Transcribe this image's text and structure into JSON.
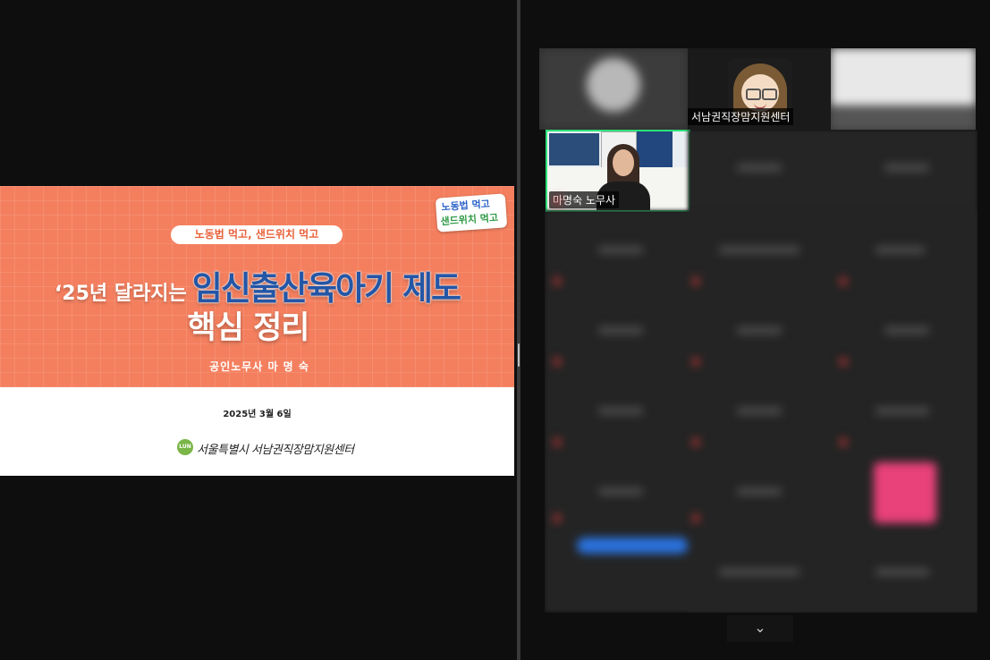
{
  "slide": {
    "series_label": "노동법 먹고, 샌드위치 먹고",
    "logo_line1": "노동법 먹고",
    "logo_line2": "샌드위치 먹고",
    "title_prefix": "‘25년 달라지는",
    "title_highlight": "임신출산육아기 제도",
    "title_line2": "핵심 정리",
    "presenter": "공인노무사  마 명 숙",
    "date": "2025년  3월 6일",
    "org_logo_text": "LUN",
    "org_name": "서울특별시 서남권직장맘지원센터"
  },
  "gallery": {
    "avatar_participant_name": "서남권직장맘지원센터",
    "active_speaker_name": "마명숙 노무사",
    "scroll_down_icon": "⌄"
  },
  "colors": {
    "slide_orange": "#f47f5e",
    "title_blue": "#2456a6",
    "active_speaker_border": "#2ee27a",
    "background": "#0e0e0e"
  }
}
